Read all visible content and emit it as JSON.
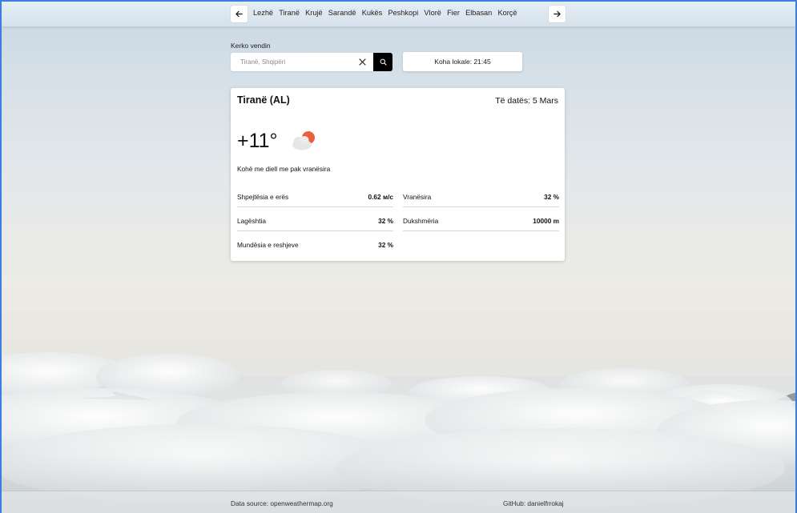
{
  "nav": {
    "prev_icon": "arrow-left-icon",
    "next_icon": "arrow-right-icon",
    "cities": [
      "Lezhë",
      "Tiranë",
      "Krujë",
      "Sarandë",
      "Kukës",
      "Peshkopi",
      "Vlorë",
      "Fier",
      "Elbasan",
      "Korçë"
    ]
  },
  "search": {
    "label": "Kerko vendin",
    "placeholder": "Tiranë, Shqipëri",
    "value": "",
    "clear_icon": "close-icon",
    "search_icon": "search-icon"
  },
  "localtime": "Koha lokale: 21:45",
  "weather": {
    "city": "Tiranë (AL)",
    "date": "Të datës: 5 Mars",
    "temperature": "+11°",
    "icon": "partly-cloudy-icon",
    "description": "Kohë me diell me pak vranësira",
    "stats": [
      {
        "label": "Shpejtësia e erës",
        "value": "0.62 м/с"
      },
      {
        "label": "Vranësira",
        "value": "32 %"
      },
      {
        "label": "Lagështia",
        "value": "32 %"
      },
      {
        "label": "Dukshmëria",
        "value": "10000 m"
      },
      {
        "label": "Mundësia e reshjeve",
        "value": "32 %"
      }
    ]
  },
  "footer": {
    "source": "Data source: openweathermap.org",
    "github": "GitHub: danielfrrokaj"
  },
  "colors": {
    "accent": "#000000",
    "sun": "#e8613c",
    "window_border": "#3b7ee0"
  }
}
